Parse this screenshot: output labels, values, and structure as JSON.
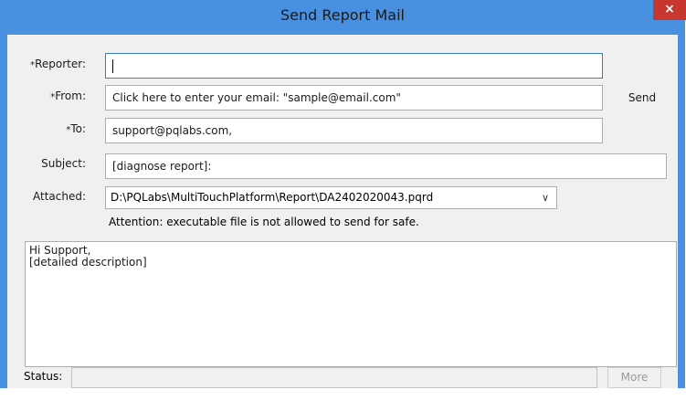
{
  "window": {
    "title": "Send Report Mail",
    "close_symbol": "×"
  },
  "form": {
    "reporter": {
      "required_mark": "*",
      "label": "Reporter:",
      "value": ""
    },
    "from": {
      "required_mark": "*",
      "label": "From:",
      "value": "Click here to enter your email: \"sample@email.com\""
    },
    "to": {
      "required_mark": "*",
      "label": "To:",
      "value": "support@pqlabs.com,"
    },
    "subject": {
      "label": "Subject:",
      "value": "[diagnose report]:"
    },
    "attached": {
      "label": "Attached:",
      "value": "D:\\PQLabs\\MultiTouchPlatform\\Report\\DA2402020043.pqrd"
    },
    "attention": "Attention: executable file is not allowed to send for safe.",
    "body_text": "Hi Support,\n[detailed description]"
  },
  "buttons": {
    "send_label": "Send",
    "more_label": "More"
  },
  "status": {
    "label": "Status:",
    "value": ""
  },
  "colors": {
    "titlebar": "#4a90e0",
    "close": "#c7372f",
    "client": "#f0f0f0"
  }
}
